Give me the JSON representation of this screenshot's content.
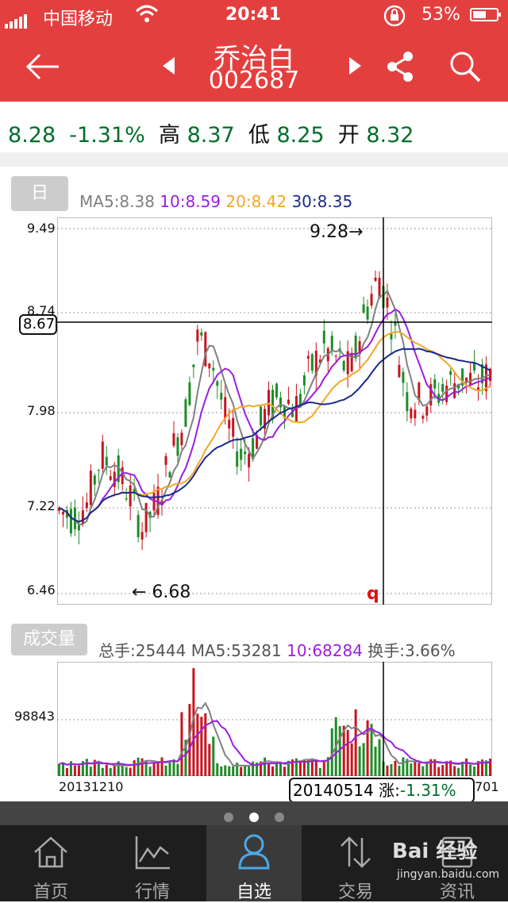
{
  "status_bar": {
    "carrier": "中国移动",
    "time": "20:41",
    "battery": "53%"
  },
  "header": {
    "stock_name": "乔治白",
    "stock_code": "002687"
  },
  "quote": {
    "price": "8.28",
    "change_pct": "-1.31%",
    "high_label": "高",
    "high": "8.37",
    "low_label": "低",
    "low": "8.25",
    "open_label": "开",
    "open": "8.32"
  },
  "kline": {
    "tab_label": "日",
    "ma5": "MA5:8.38",
    "ma10": "10:8.59",
    "ma20": "20:8.42",
    "ma30": "30:8.35",
    "ma_colors": {
      "ma5": "#808080",
      "ma10": "#9b1ee0",
      "ma20": "#f5a623",
      "ma30": "#1a2a8c"
    },
    "y_ticks": [
      "9.49",
      "8.74",
      "7.98",
      "7.22",
      "6.46"
    ],
    "crosshair_value": "8.67",
    "high_mark": "9.28→",
    "low_mark": "← 6.68",
    "cursor_marker": "q",
    "up_color": "#c8141e",
    "down_color": "#1e8c28"
  },
  "volume": {
    "tab_label": "成交量",
    "total": "总手:25444",
    "ma5": "MA5:53281",
    "ma10": "10:68284",
    "turnover": "换手:3.66%",
    "y_tick": "98843",
    "start_date": "20131210",
    "end_date_partial": "701",
    "cursor_date": "20140514",
    "cursor_change_label": "涨:",
    "cursor_change": "-1.31%"
  },
  "bottom_nav": [
    {
      "label": "首页",
      "icon": "home-icon"
    },
    {
      "label": "行情",
      "icon": "chart-line-icon"
    },
    {
      "label": "自选",
      "icon": "user-icon"
    },
    {
      "label": "交易",
      "icon": "trade-arrows-icon"
    },
    {
      "label": "资讯",
      "icon": "news-icon"
    }
  ],
  "watermark": {
    "text": "Bai 经验",
    "sub": "jingyan.baidu.com"
  }
}
